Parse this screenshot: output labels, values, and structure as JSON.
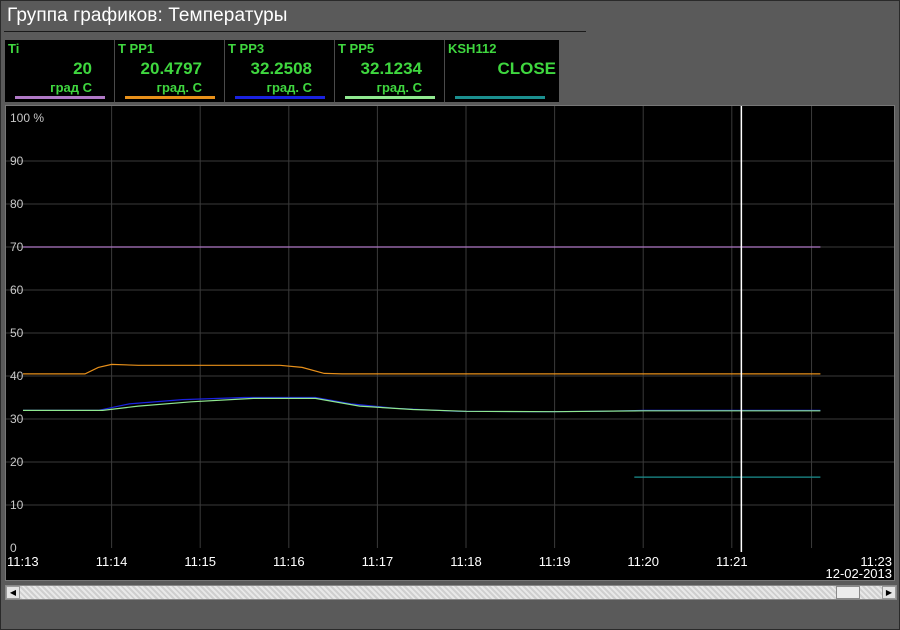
{
  "window": {
    "title": "Группа графиков: Температуры"
  },
  "legend": [
    {
      "name": "Ti",
      "value": "20",
      "unit": "град C",
      "color": "#b079c6"
    },
    {
      "name": "T PP1",
      "value": "20.4797",
      "unit": "град. С",
      "color": "#e8901a"
    },
    {
      "name": "T PP3",
      "value": "32.2508",
      "unit": "град. С",
      "color": "#1a22e0"
    },
    {
      "name": "T PP5",
      "value": "32.1234",
      "unit": "град. С",
      "color": "#90e890"
    },
    {
      "name": "KSH112",
      "value": "CLOSE",
      "unit": "",
      "color": "#1b8f8f"
    }
  ],
  "chart_data": {
    "type": "line",
    "ylabel_unit": "%",
    "ylim": [
      0,
      100
    ],
    "y_ticks": [
      "100 %",
      "90",
      "80",
      "70",
      "60",
      "50",
      "40",
      "30",
      "20",
      "10",
      "0"
    ],
    "x_ticks": [
      "11:13",
      "11:14",
      "11:15",
      "11:16",
      "11:17",
      "11:18",
      "11:19",
      "11:20",
      "11:21",
      "11:23"
    ],
    "x_range_minutes": [
      0,
      9.5
    ],
    "date": "12-02-2013",
    "cursor_minute": 7.6,
    "grid": true,
    "series": [
      {
        "name": "Ti",
        "color": "#b079c6",
        "points": [
          [
            0,
            70
          ],
          [
            9.0,
            70
          ]
        ]
      },
      {
        "name": "T PP1",
        "color": "#e8901a",
        "points": [
          [
            0,
            40.5
          ],
          [
            0.7,
            40.5
          ],
          [
            0.85,
            42
          ],
          [
            1.0,
            42.7
          ],
          [
            1.3,
            42.5
          ],
          [
            2.0,
            42.5
          ],
          [
            2.9,
            42.5
          ],
          [
            3.15,
            42
          ],
          [
            3.4,
            40.6
          ],
          [
            3.6,
            40.5
          ],
          [
            5.9,
            40.5
          ],
          [
            6.6,
            40.5
          ],
          [
            9.0,
            40.5
          ]
        ]
      },
      {
        "name": "T PP3",
        "color": "#1a22e0",
        "points": [
          [
            0,
            32
          ],
          [
            0.85,
            32
          ],
          [
            1.2,
            33.5
          ],
          [
            1.8,
            34.5
          ],
          [
            2.5,
            35
          ],
          [
            3.3,
            35
          ],
          [
            3.7,
            33.5
          ],
          [
            4.2,
            32.5
          ],
          [
            4.9,
            31.8
          ],
          [
            5.8,
            31.7
          ],
          [
            6.5,
            31.8
          ],
          [
            7.0,
            32
          ],
          [
            8.2,
            32
          ],
          [
            9.0,
            32
          ]
        ]
      },
      {
        "name": "T PP5",
        "color": "#90e890",
        "points": [
          [
            0,
            32
          ],
          [
            0.9,
            32
          ],
          [
            1.3,
            33
          ],
          [
            1.9,
            34
          ],
          [
            2.6,
            34.8
          ],
          [
            3.3,
            34.8
          ],
          [
            3.8,
            33
          ],
          [
            4.4,
            32.2
          ],
          [
            5.0,
            31.8
          ],
          [
            6.0,
            31.7
          ],
          [
            7.0,
            31.9
          ],
          [
            9.0,
            31.9
          ]
        ]
      },
      {
        "name": "KSH112",
        "color": "#1b8f8f",
        "points": [
          [
            6.9,
            16.5
          ],
          [
            9.0,
            16.5
          ]
        ]
      }
    ]
  }
}
